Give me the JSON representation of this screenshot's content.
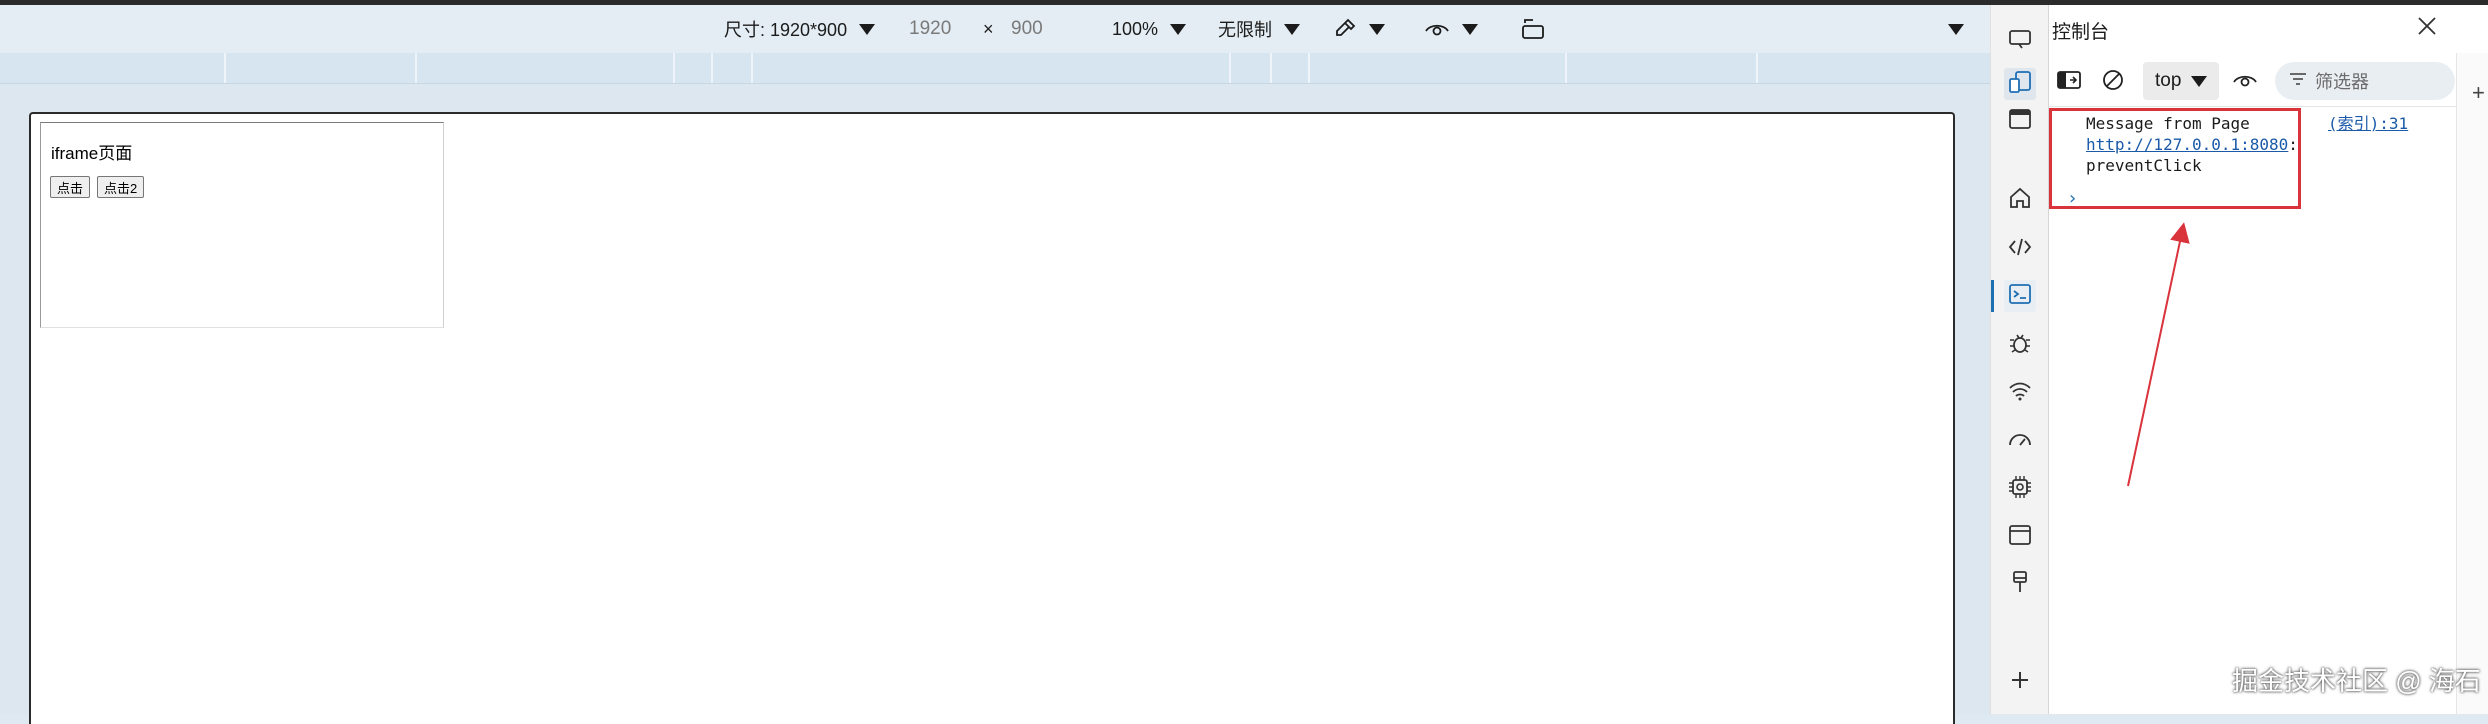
{
  "device_toolbar": {
    "dimensions_label": "尺寸: 1920*900",
    "width_value": "1920",
    "times": "×",
    "height_value": "900",
    "zoom": "100%",
    "throttle": "无限制"
  },
  "page": {
    "iframe_title": "iframe页面",
    "button1": "点击",
    "button2": "点击2"
  },
  "activity_bar": {
    "icons": [
      "device-emulation-icon",
      "screencast-icon",
      "dock-icon",
      "home-icon",
      "elements-icon",
      "console-icon",
      "sources-icon",
      "network-icon",
      "performance-icon",
      "memory-icon",
      "application-icon",
      "css-overview-icon",
      "add-tool-icon"
    ]
  },
  "console": {
    "panel_title": "控制台",
    "context": "top",
    "filter_placeholder": "筛选器",
    "log_message": "Message from Page",
    "log_link": "http://127.0.0.1:8080",
    "log_colon": ":",
    "log_value": "preventClick",
    "log_source": "(索引):31",
    "prompt": "›"
  },
  "watermark": "掘金技术社区 @ 海石",
  "colors": {
    "highlight": "#d9333c",
    "accent": "#1f6fb3",
    "link": "#1a5aa8"
  }
}
